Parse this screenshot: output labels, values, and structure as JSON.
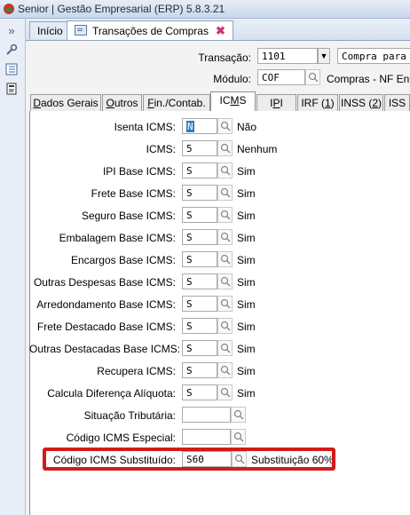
{
  "window": {
    "title": "Senior | Gestão Empresarial (ERP) 5.8.3.21"
  },
  "tabs": [
    {
      "label": "Início"
    },
    {
      "label": "Transações de Compras"
    }
  ],
  "header": {
    "transacao": {
      "label": "Transação:",
      "value": "1101",
      "description": "Compra para"
    },
    "modulo": {
      "label": "Módulo:",
      "value": "COF",
      "description": "Compras - NF Entr"
    }
  },
  "subtabs": [
    {
      "label": "Dados Gerais",
      "key": "D"
    },
    {
      "label": "Outros",
      "key": "O"
    },
    {
      "label": "Fin./Contab.",
      "key": "F"
    },
    {
      "label": "ICMS",
      "key": "M"
    },
    {
      "label": "IPI",
      "key": "P"
    },
    {
      "label": "IRF (1)",
      "key": "1"
    },
    {
      "label": "INSS (2)",
      "key": "2"
    },
    {
      "label": "ISS",
      "key": ""
    }
  ],
  "fields": [
    {
      "label": "Isenta ICMS:",
      "value": "N",
      "description": "Não"
    },
    {
      "label": "ICMS:",
      "value": "5",
      "description": "Nenhum"
    },
    {
      "label": "IPI Base ICMS:",
      "value": "S",
      "description": "Sim"
    },
    {
      "label": "Frete Base ICMS:",
      "value": "S",
      "description": "Sim"
    },
    {
      "label": "Seguro Base ICMS:",
      "value": "S",
      "description": "Sim"
    },
    {
      "label": "Embalagem Base ICMS:",
      "value": "S",
      "description": "Sim"
    },
    {
      "label": "Encargos Base ICMS:",
      "value": "S",
      "description": "Sim"
    },
    {
      "label": "Outras Despesas Base ICMS:",
      "value": "S",
      "description": "Sim"
    },
    {
      "label": "Arredondamento Base ICMS:",
      "value": "S",
      "description": "Sim"
    },
    {
      "label": "Frete Destacado Base ICMS:",
      "value": "S",
      "description": "Sim"
    },
    {
      "label": "Outras Destacadas Base ICMS:",
      "value": "S",
      "description": "Sim"
    },
    {
      "label": "Recupera ICMS:",
      "value": "S",
      "description": "Sim"
    },
    {
      "label": "Calcula Diferença Alíquota:",
      "value": "S",
      "description": "Sim"
    },
    {
      "label": "Situação Tributária:",
      "value": "",
      "description": ""
    },
    {
      "label": "Código ICMS Especial:",
      "value": "",
      "description": ""
    },
    {
      "label": "Código ICMS Substituído:",
      "value": "S60",
      "description": "Substituição 60%"
    }
  ],
  "colors": {
    "highlight": "#d31a1a",
    "tab_close": "#c8367a"
  },
  "icons": [
    "app-logo-icon",
    "expand-icon",
    "wrench-icon",
    "list-icon",
    "document-icon",
    "form-icon",
    "close-icon",
    "search-icon",
    "dropdown-icon"
  ]
}
